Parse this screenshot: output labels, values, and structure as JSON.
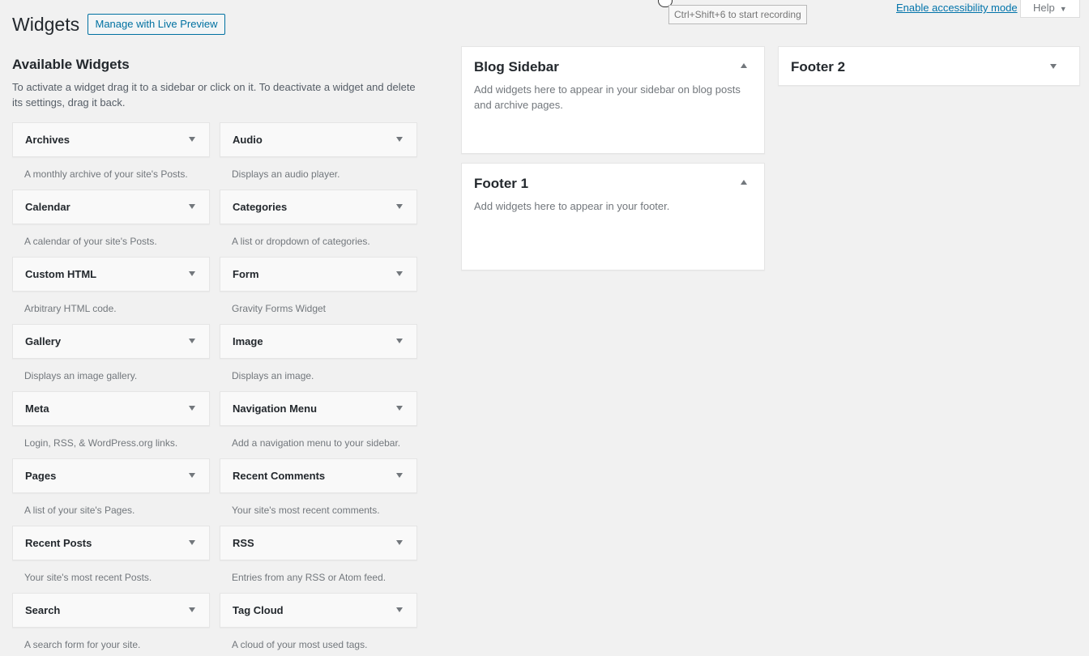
{
  "header": {
    "title": "Widgets",
    "live_preview_label": "Manage with Live Preview",
    "tooltip": "Ctrl+Shift+6 to start recording",
    "accessibility_link": "Enable accessibility mode",
    "help_label": "Help"
  },
  "available": {
    "title": "Available Widgets",
    "description": "To activate a widget drag it to a sidebar or click on it. To deactivate a widget and delete its settings, drag it back.",
    "widgets": [
      {
        "title": "Archives",
        "desc": "A monthly archive of your site's Posts."
      },
      {
        "title": "Audio",
        "desc": "Displays an audio player."
      },
      {
        "title": "Calendar",
        "desc": "A calendar of your site's Posts."
      },
      {
        "title": "Categories",
        "desc": "A list or dropdown of categories."
      },
      {
        "title": "Custom HTML",
        "desc": "Arbitrary HTML code."
      },
      {
        "title": "Form",
        "desc": "Gravity Forms Widget"
      },
      {
        "title": "Gallery",
        "desc": "Displays an image gallery."
      },
      {
        "title": "Image",
        "desc": "Displays an image."
      },
      {
        "title": "Meta",
        "desc": "Login, RSS, & WordPress.org links."
      },
      {
        "title": "Navigation Menu",
        "desc": "Add a navigation menu to your sidebar."
      },
      {
        "title": "Pages",
        "desc": "A list of your site's Pages."
      },
      {
        "title": "Recent Comments",
        "desc": "Your site's most recent comments."
      },
      {
        "title": "Recent Posts",
        "desc": "Your site's most recent Posts."
      },
      {
        "title": "RSS",
        "desc": "Entries from any RSS or Atom feed."
      },
      {
        "title": "Search",
        "desc": "A search form for your site."
      },
      {
        "title": "Tag Cloud",
        "desc": "A cloud of your most used tags."
      }
    ]
  },
  "sidebars": {
    "blog": {
      "title": "Blog Sidebar",
      "desc": "Add widgets here to appear in your sidebar on blog posts and archive pages.",
      "state": "expanded"
    },
    "footer1": {
      "title": "Footer 1",
      "desc": "Add widgets here to appear in your footer.",
      "state": "expanded"
    },
    "footer2": {
      "title": "Footer 2",
      "state": "collapsed"
    }
  },
  "icons": {
    "widget_toggle": "chevron-down-icon",
    "sidebar_expanded": "chevron-up-icon",
    "sidebar_collapsed": "chevron-down-icon"
  }
}
